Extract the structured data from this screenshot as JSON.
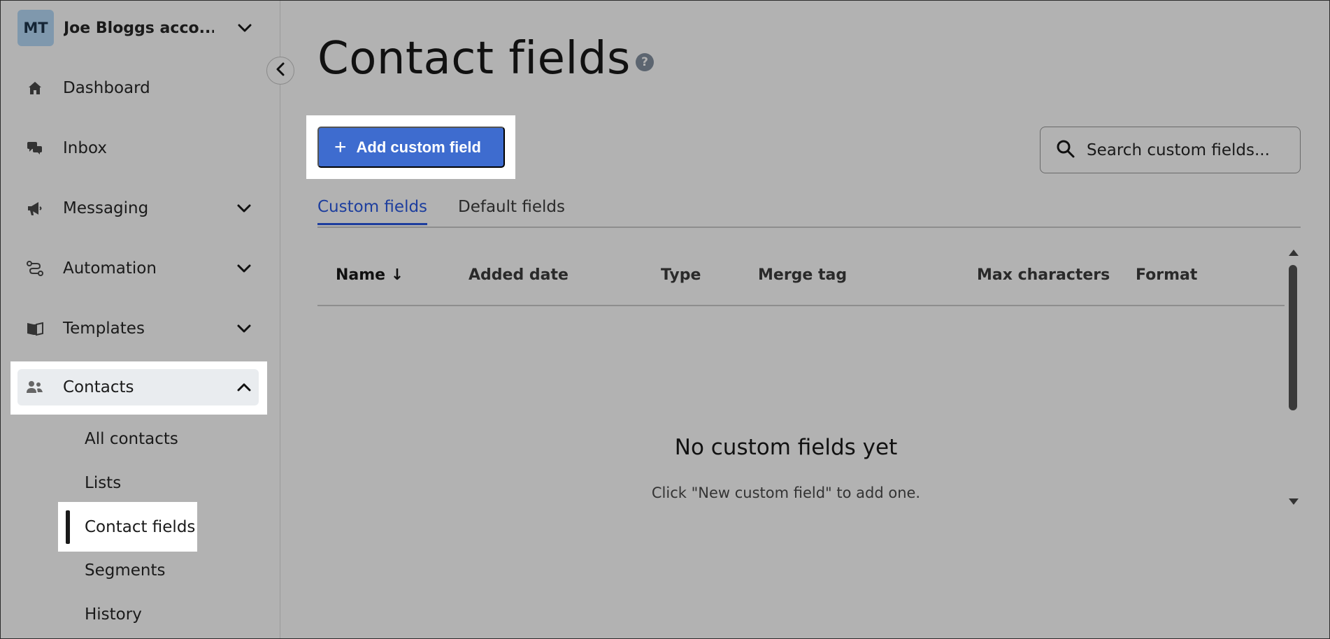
{
  "account": {
    "initials": "MT",
    "name": "Joe Bloggs acco..."
  },
  "sidebar": {
    "items": [
      {
        "label": "Dashboard",
        "icon": "home-icon"
      },
      {
        "label": "Inbox",
        "icon": "chat-icon"
      },
      {
        "label": "Messaging",
        "icon": "megaphone-icon",
        "expandable": true
      },
      {
        "label": "Automation",
        "icon": "automation-icon",
        "expandable": true
      },
      {
        "label": "Templates",
        "icon": "book-icon",
        "expandable": true
      },
      {
        "label": "Contacts",
        "icon": "users-icon",
        "expanded": true
      }
    ],
    "contacts_sub": [
      "All contacts",
      "Lists",
      "Contact fields",
      "Segments",
      "History"
    ],
    "active_sub": "Contact fields"
  },
  "main": {
    "title": "Contact fields",
    "help_glyph": "?",
    "add_button": "Add custom field",
    "search_placeholder": "Search custom fields...",
    "tabs": [
      {
        "label": "Custom fields",
        "active": true
      },
      {
        "label": "Default fields",
        "active": false
      }
    ],
    "columns": [
      "Name",
      "Added date",
      "Type",
      "Merge tag",
      "Max characters",
      "Format"
    ],
    "sort_indicator": "↓",
    "empty_title": "No custom fields yet",
    "empty_sub": "Click \"New custom field\" to add one."
  },
  "colors": {
    "background": "#b2b2b2",
    "primary_button": "#3e6ccf",
    "active_tab": "#1d3e9e",
    "highlight": "#ffffff"
  }
}
